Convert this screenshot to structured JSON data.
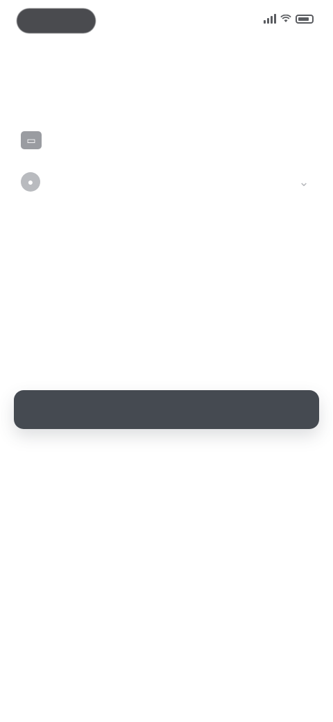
{
  "status_bar": {
    "time": "",
    "icons": [
      "signal-icon",
      "wifi-icon",
      "battery-icon"
    ]
  },
  "section": {
    "title": ""
  },
  "rows": [
    {
      "icon": "card-icon",
      "text": ""
    },
    {
      "icon": "person-icon",
      "input_value": "",
      "placeholder": "",
      "trailing_icon": "chevron-down-icon"
    }
  ],
  "helper_text": "",
  "primary_button": {
    "label": ""
  },
  "colors": {
    "background": "#ffffff",
    "button": "#454a51",
    "pill": "#4a4b4f",
    "text_primary": "#2d3036",
    "text_muted": "#8a8d93"
  }
}
